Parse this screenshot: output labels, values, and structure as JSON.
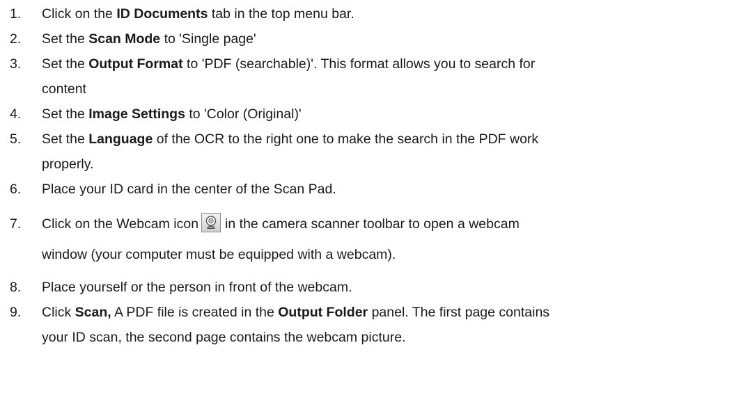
{
  "steps": [
    {
      "number": "1.",
      "parts": [
        "Click on the ",
        "ID Documents",
        " tab in the top menu bar."
      ]
    },
    {
      "number": "2.",
      "parts": [
        "Set the ",
        "Scan Mode",
        " to 'Single page'"
      ]
    },
    {
      "number": "3.",
      "parts": [
        "Set the ",
        "Output Format",
        " to 'PDF (searchable)'. This format allows you to search for",
        "content"
      ]
    },
    {
      "number": "4.",
      "parts": [
        "Set the ",
        "Image Settings",
        " to 'Color (Original)'"
      ]
    },
    {
      "number": "5.",
      "parts": [
        "Set the ",
        "Language",
        " of the OCR to the right one to make the search in the PDF work",
        "properly."
      ]
    },
    {
      "number": "6.",
      "parts": [
        "Place your ID card in the center of the Scan Pad."
      ]
    },
    {
      "number": "7.",
      "parts": [
        "Click on the Webcam icon",
        "in the camera scanner toolbar to open a webcam",
        "window (your computer must be equipped with a webcam)."
      ],
      "icon": "webcam-icon"
    },
    {
      "number": "8.",
      "parts": [
        "Place yourself or the person in front of the webcam."
      ]
    },
    {
      "number": "9.",
      "parts": [
        "Click ",
        "Scan,",
        " A PDF file is created in the ",
        "Output Folder",
        " panel. The first page contains",
        "your ID scan, the second page contains the webcam picture."
      ]
    }
  ]
}
